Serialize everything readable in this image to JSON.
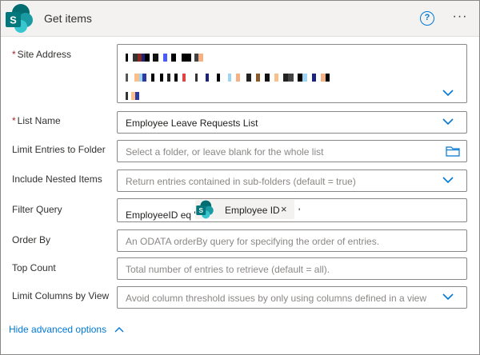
{
  "header": {
    "title": "Get items",
    "help_label": "?",
    "more_label": "···"
  },
  "fields": {
    "site_address": {
      "label": "Site Address",
      "required_mark": "*"
    },
    "list_name": {
      "label": "List Name",
      "required_mark": "*",
      "value": "Employee Leave Requests List"
    },
    "limit_entries_to_folder": {
      "label": "Limit Entries to Folder",
      "placeholder": "Select a folder, or leave blank for the whole list"
    },
    "include_nested_items": {
      "label": "Include Nested Items",
      "placeholder": "Return entries contained in sub-folders (default = true)"
    },
    "filter_query": {
      "label": "Filter Query",
      "prefix": "EmployeeID eq '",
      "token_label": "Employee ID",
      "token_remove": "×",
      "suffix": "'"
    },
    "order_by": {
      "label": "Order By",
      "placeholder": "An ODATA orderBy query for specifying the order of entries."
    },
    "top_count": {
      "label": "Top Count",
      "placeholder": "Total number of entries to retrieve (default = all)."
    },
    "limit_columns_by_view": {
      "label": "Limit Columns by View",
      "placeholder": "Avoid column threshold issues by only using columns defined in a view"
    }
  },
  "advanced_toggle": {
    "label": "Hide advanced options"
  },
  "colors": {
    "accent": "#0078d4",
    "required": "#a4262c",
    "sharepoint_dark": "#036c70",
    "sharepoint_mid": "#1a9ba1",
    "sharepoint_light": "#37c6d0"
  }
}
